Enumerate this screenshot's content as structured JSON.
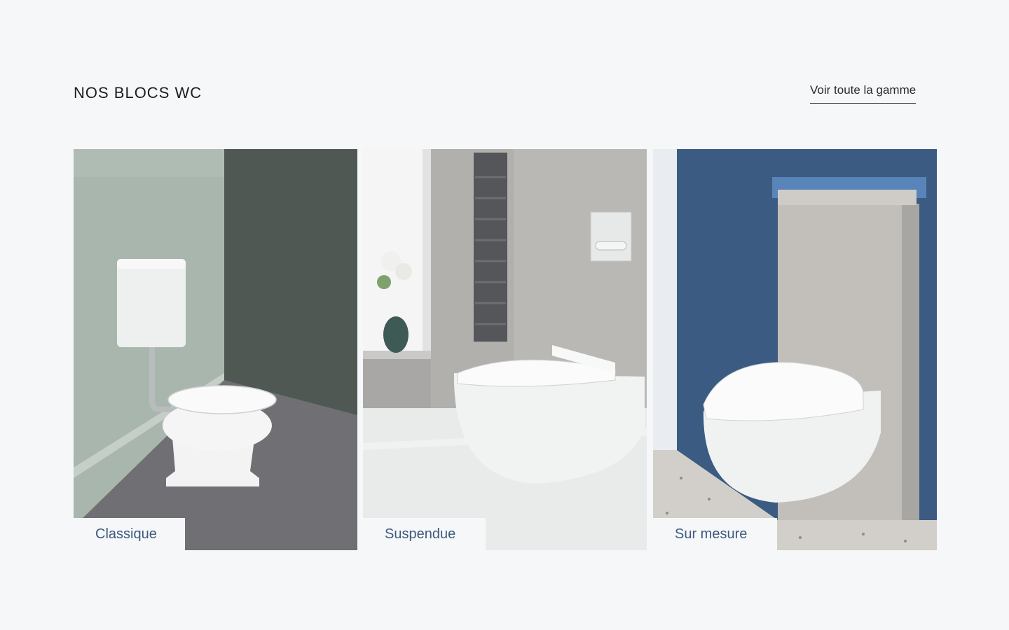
{
  "section": {
    "title": "NOS BLOCS WC",
    "view_all_label": "Voir toute la gamme"
  },
  "cards": [
    {
      "label": "Classique"
    },
    {
      "label": "Suspendue"
    },
    {
      "label": "Sur mesure"
    }
  ]
}
